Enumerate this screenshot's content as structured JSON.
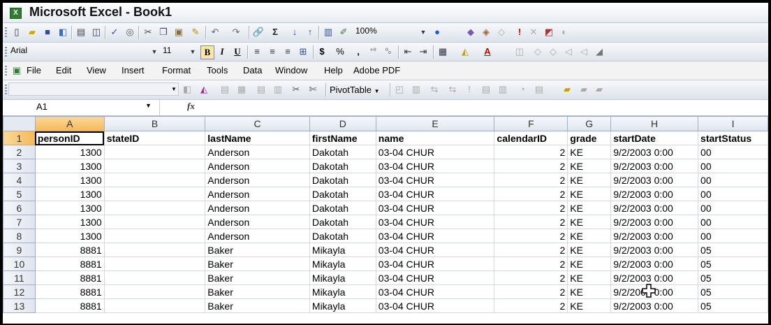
{
  "window": {
    "title": "Microsoft Excel - Book1"
  },
  "toolbar_standard": {
    "zoom": "100%"
  },
  "toolbar_formatting": {
    "font_name": "Arial",
    "font_size": "11",
    "bold": "B",
    "italic": "I",
    "underline": "U",
    "currency": "$",
    "percent": "%",
    "comma": ","
  },
  "menu": {
    "items": [
      "File",
      "Edit",
      "View",
      "Insert",
      "Format",
      "Tools",
      "Data",
      "Window",
      "Help",
      "Adobe PDF"
    ]
  },
  "toolbar_pivot": {
    "pivot_label": "PivotTable"
  },
  "formula_bar": {
    "name_box": "A1",
    "fx": "fx",
    "value": ""
  },
  "sheet": {
    "columns": [
      "A",
      "B",
      "C",
      "D",
      "E",
      "F",
      "G",
      "H",
      "I"
    ],
    "rows": [
      {
        "n": "1",
        "cells": [
          "personID",
          "stateID",
          "lastName",
          "firstName",
          "name",
          "calendarID",
          "grade",
          "startDate",
          "startStatus"
        ]
      },
      {
        "n": "2",
        "cells": [
          "1300",
          "",
          "Anderson",
          "Dakotah",
          "03-04 CHUR",
          "2",
          "KE",
          "9/2/2003 0:00",
          "00"
        ]
      },
      {
        "n": "3",
        "cells": [
          "1300",
          "",
          "Anderson",
          "Dakotah",
          "03-04 CHUR",
          "2",
          "KE",
          "9/2/2003 0:00",
          "00"
        ]
      },
      {
        "n": "4",
        "cells": [
          "1300",
          "",
          "Anderson",
          "Dakotah",
          "03-04 CHUR",
          "2",
          "KE",
          "9/2/2003 0:00",
          "00"
        ]
      },
      {
        "n": "5",
        "cells": [
          "1300",
          "",
          "Anderson",
          "Dakotah",
          "03-04 CHUR",
          "2",
          "KE",
          "9/2/2003 0:00",
          "00"
        ]
      },
      {
        "n": "6",
        "cells": [
          "1300",
          "",
          "Anderson",
          "Dakotah",
          "03-04 CHUR",
          "2",
          "KE",
          "9/2/2003 0:00",
          "00"
        ]
      },
      {
        "n": "7",
        "cells": [
          "1300",
          "",
          "Anderson",
          "Dakotah",
          "03-04 CHUR",
          "2",
          "KE",
          "9/2/2003 0:00",
          "00"
        ]
      },
      {
        "n": "8",
        "cells": [
          "1300",
          "",
          "Anderson",
          "Dakotah",
          "03-04 CHUR",
          "2",
          "KE",
          "9/2/2003 0:00",
          "00"
        ]
      },
      {
        "n": "9",
        "cells": [
          "8881",
          "",
          "Baker",
          "Mikayla",
          "03-04 CHUR",
          "2",
          "KE",
          "9/2/2003 0:00",
          "05"
        ]
      },
      {
        "n": "10",
        "cells": [
          "8881",
          "",
          "Baker",
          "Mikayla",
          "03-04 CHUR",
          "2",
          "KE",
          "9/2/2003 0:00",
          "05"
        ]
      },
      {
        "n": "11",
        "cells": [
          "8881",
          "",
          "Baker",
          "Mikayla",
          "03-04 CHUR",
          "2",
          "KE",
          "9/2/2003 0:00",
          "05"
        ]
      },
      {
        "n": "12",
        "cells": [
          "8881",
          "",
          "Baker",
          "Mikayla",
          "03-04 CHUR",
          "2",
          "KE",
          "9/2/2003 0:00",
          "05"
        ]
      },
      {
        "n": "13",
        "cells": [
          "8881",
          "",
          "Baker",
          "Mikayla",
          "03-04 CHUR",
          "2",
          "KE",
          "9/2/2003 0:00",
          "05"
        ]
      }
    ]
  },
  "colors": {
    "titlebar_text": "#111111",
    "selected_header": "#f5b957",
    "gridline": "#d0d7e5"
  }
}
